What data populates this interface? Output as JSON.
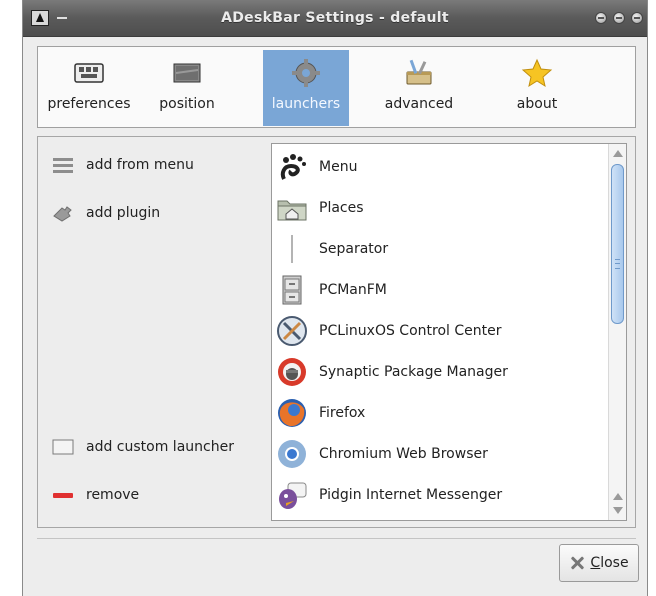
{
  "window": {
    "title": "ADeskBar Settings - default"
  },
  "tabs": [
    {
      "label": "preferences",
      "icon": "keyboard-icon",
      "active": false
    },
    {
      "label": "position",
      "icon": "screen-icon",
      "active": false
    },
    {
      "label": "launchers",
      "icon": "gear-icon",
      "active": true
    },
    {
      "label": "advanced",
      "icon": "toolbox-icon",
      "active": false
    },
    {
      "label": "about",
      "icon": "star-icon",
      "active": false
    }
  ],
  "actions": {
    "add_from_menu": "add from menu",
    "add_plugin": "add plugin",
    "add_custom_launcher": "add custom launcher",
    "remove": "remove"
  },
  "launchers": [
    {
      "label": "Menu",
      "icon": "gnome-foot-icon"
    },
    {
      "label": "Places",
      "icon": "folder-home-icon"
    },
    {
      "label": "Separator",
      "icon": "separator-icon"
    },
    {
      "label": "PCManFM",
      "icon": "file-cabinet-icon"
    },
    {
      "label": "PCLinuxOS Control Center",
      "icon": "control-center-icon"
    },
    {
      "label": "Synaptic Package Manager",
      "icon": "synaptic-icon"
    },
    {
      "label": "Firefox",
      "icon": "firefox-icon"
    },
    {
      "label": "Chromium Web Browser",
      "icon": "chromium-icon"
    },
    {
      "label": "Pidgin Internet Messenger",
      "icon": "pidgin-icon"
    }
  ],
  "buttons": {
    "close_mnemonic": "C",
    "close_rest": "lose"
  },
  "colors": {
    "active_tab": "#7aa6d6",
    "titlebar": "#5a5a5a",
    "remove": "#e03030"
  }
}
